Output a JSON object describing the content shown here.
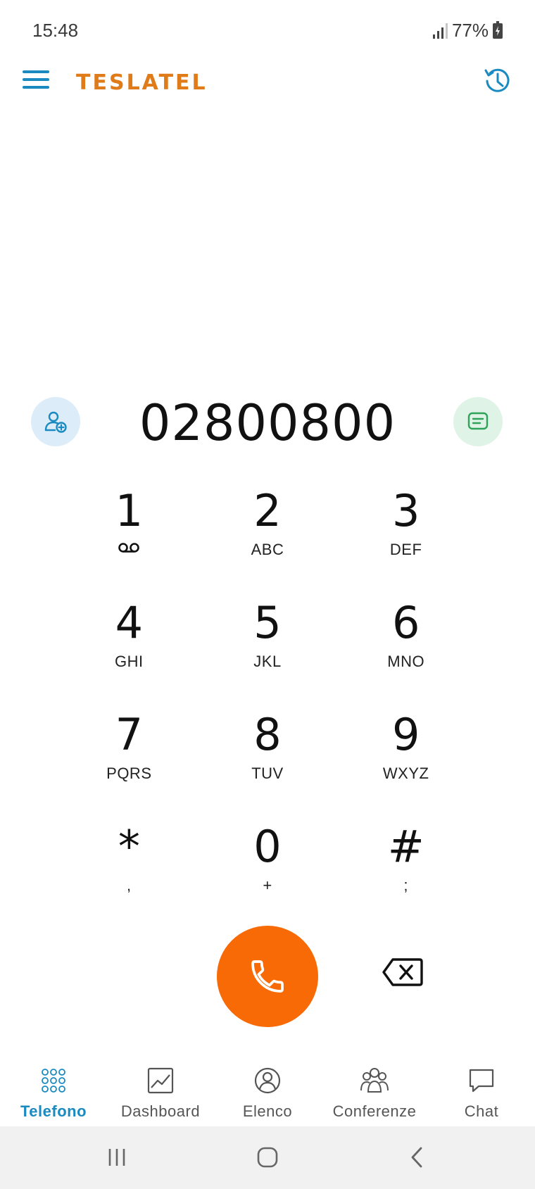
{
  "status_bar": {
    "time": "15:48",
    "battery": "77%"
  },
  "header": {
    "logo_text": "TESLATEL",
    "brand_color": "#e07b1a",
    "accent_color": "#1a8ac0"
  },
  "dialer": {
    "number": "02800800",
    "call_color": "#f76a06",
    "keys": [
      {
        "digit": "1",
        "letters": ""
      },
      {
        "digit": "2",
        "letters": "ABC"
      },
      {
        "digit": "3",
        "letters": "DEF"
      },
      {
        "digit": "4",
        "letters": "GHI"
      },
      {
        "digit": "5",
        "letters": "JKL"
      },
      {
        "digit": "6",
        "letters": "MNO"
      },
      {
        "digit": "7",
        "letters": "PQRS"
      },
      {
        "digit": "8",
        "letters": "TUV"
      },
      {
        "digit": "9",
        "letters": "WXYZ"
      },
      {
        "digit": "*",
        "letters": ","
      },
      {
        "digit": "0",
        "letters": "+"
      },
      {
        "digit": "#",
        "letters": ";"
      }
    ]
  },
  "bottom_nav": {
    "items": [
      {
        "label": "Telefono",
        "icon": "dialpad-icon",
        "active": true
      },
      {
        "label": "Dashboard",
        "icon": "chart-icon",
        "active": false
      },
      {
        "label": "Elenco",
        "icon": "contact-icon",
        "active": false
      },
      {
        "label": "Conferenze",
        "icon": "group-icon",
        "active": false
      },
      {
        "label": "Chat",
        "icon": "chat-icon",
        "active": false
      }
    ]
  }
}
